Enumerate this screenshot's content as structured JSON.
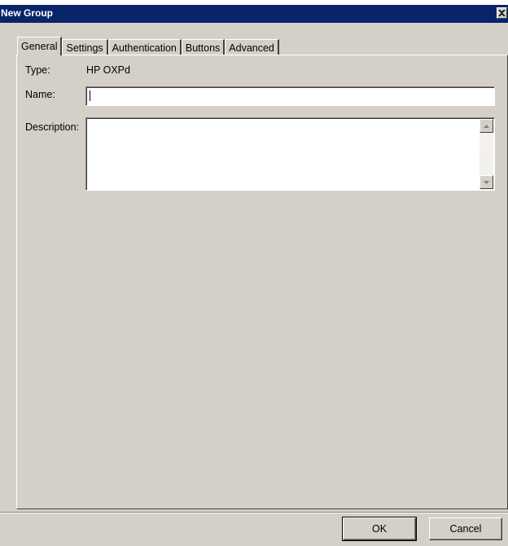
{
  "window": {
    "title": "New Group"
  },
  "tabs": [
    {
      "label": "General",
      "active": true
    },
    {
      "label": "Settings",
      "active": false
    },
    {
      "label": "Authentication",
      "active": false
    },
    {
      "label": "Buttons",
      "active": false
    },
    {
      "label": "Advanced",
      "active": false
    }
  ],
  "general": {
    "type_label": "Type:",
    "type_value": "HP OXPd",
    "name_label": "Name:",
    "name_value": "",
    "description_label": "Description:",
    "description_value": ""
  },
  "footer": {
    "ok_label": "OK",
    "cancel_label": "Cancel"
  },
  "icons": {
    "close": "close-icon",
    "scroll_up": "arrow-up-icon",
    "scroll_down": "arrow-down-icon"
  },
  "colors": {
    "titlebar": "#0a246a",
    "face": "#d4d0c8",
    "title_text": "#ffffff"
  }
}
